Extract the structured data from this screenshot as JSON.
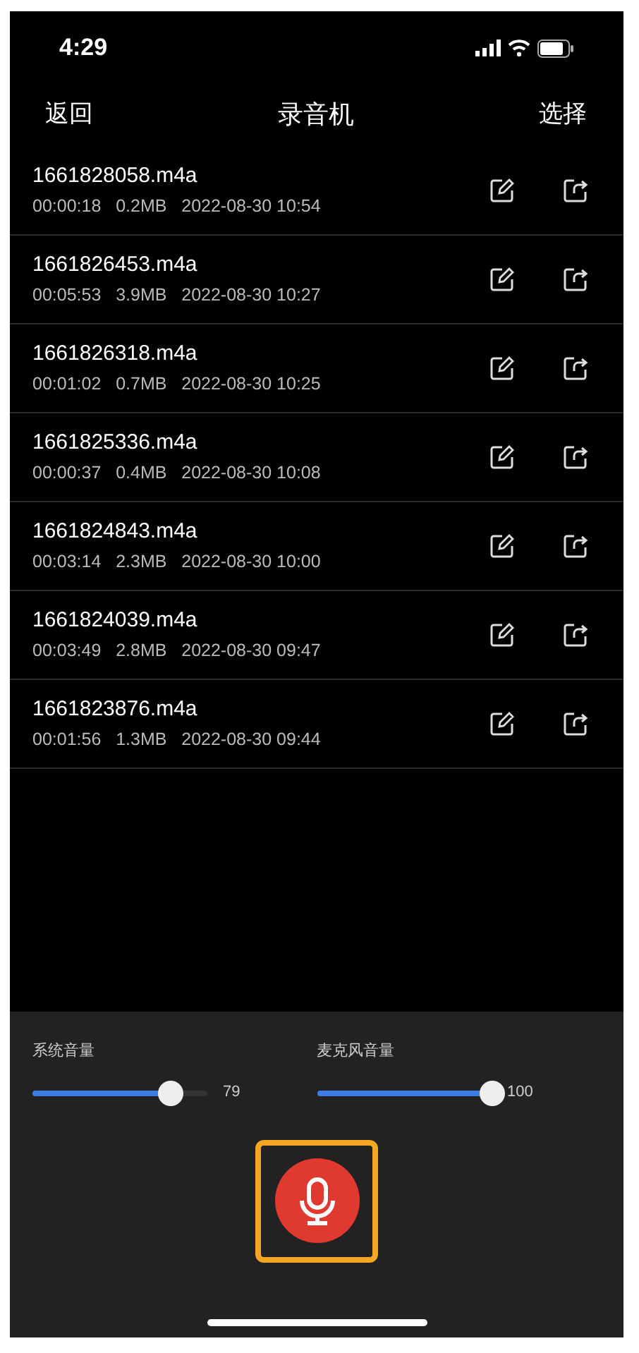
{
  "status_bar": {
    "time": "4:29"
  },
  "nav": {
    "back": "返回",
    "title": "录音机",
    "select": "选择"
  },
  "recordings": [
    {
      "name": "1661828058.m4a",
      "duration": "00:00:18",
      "size": "0.2MB",
      "date": "2022-08-30 10:54"
    },
    {
      "name": "1661826453.m4a",
      "duration": "00:05:53",
      "size": "3.9MB",
      "date": "2022-08-30 10:27"
    },
    {
      "name": "1661826318.m4a",
      "duration": "00:01:02",
      "size": "0.7MB",
      "date": "2022-08-30 10:25"
    },
    {
      "name": "1661825336.m4a",
      "duration": "00:00:37",
      "size": "0.4MB",
      "date": "2022-08-30 10:08"
    },
    {
      "name": "1661824843.m4a",
      "duration": "00:03:14",
      "size": "2.3MB",
      "date": "2022-08-30 10:00"
    },
    {
      "name": "1661824039.m4a",
      "duration": "00:03:49",
      "size": "2.8MB",
      "date": "2022-08-30 09:47"
    },
    {
      "name": "1661823876.m4a",
      "duration": "00:01:56",
      "size": "1.3MB",
      "date": "2022-08-30 09:44"
    }
  ],
  "sliders": [
    {
      "label": "系统音量",
      "level": 0.79,
      "reading": "79"
    },
    {
      "label": "麦克风音量",
      "level": 1,
      "reading": "100"
    }
  ],
  "record_button": {
    "selected": true
  }
}
